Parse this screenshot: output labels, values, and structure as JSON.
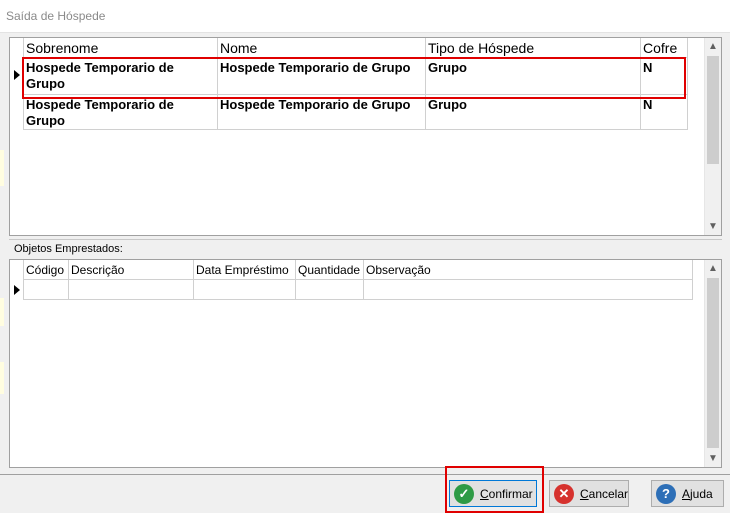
{
  "window": {
    "title": "Saída de Hóspede"
  },
  "guests_table": {
    "columns": [
      "Sobrenome",
      "Nome",
      "Tipo de Hóspede",
      "Cofre"
    ],
    "rows": [
      {
        "sobrenome": "Hospede Temporario de Grupo",
        "nome": "Hospede Temporario de Grupo",
        "tipo": "Grupo",
        "cofre": "N"
      },
      {
        "sobrenome": "Hospede Temporario de Grupo",
        "nome": "Hospede Temporario de Grupo",
        "tipo": "Grupo",
        "cofre": "N"
      }
    ]
  },
  "objects_section": {
    "label": "Objetos Emprestados:"
  },
  "objects_table": {
    "columns": [
      "Código",
      "Descrição",
      "Data Empréstimo",
      "Quantidade",
      "Observação"
    ]
  },
  "buttons": {
    "confirm": {
      "underline": "C",
      "rest": "onfirmar"
    },
    "cancel": {
      "underline": "C",
      "rest": "ancelar"
    },
    "help": {
      "underline": "A",
      "rest": "juda"
    }
  },
  "colors": {
    "highlight": "#e00000",
    "confirm_icon": "#2e9b46",
    "cancel_icon": "#d6322e",
    "help_icon": "#2d6fb7"
  },
  "icons": {
    "confirm": "check-circle-icon",
    "cancel": "x-circle-icon",
    "help": "question-circle-icon"
  }
}
